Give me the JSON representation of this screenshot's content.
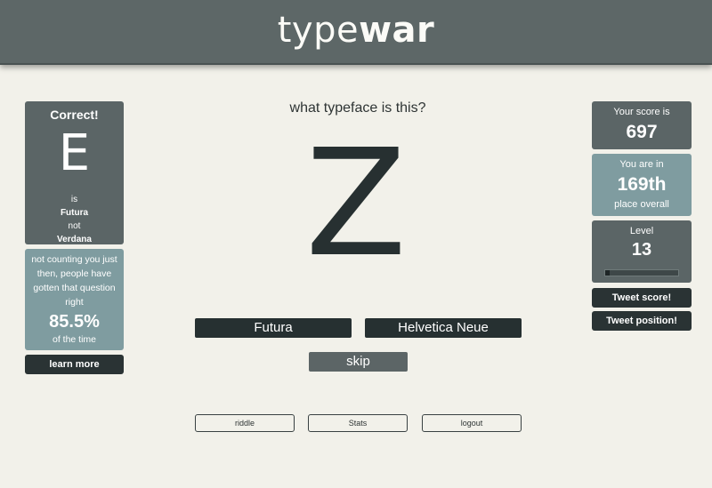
{
  "header": {
    "logo_thin": "type",
    "logo_bold": "war"
  },
  "result": {
    "title": "Correct!",
    "letter": "E",
    "is_label": "is",
    "typeface": "Futura",
    "not_label": "not",
    "other_typeface": "Verdana"
  },
  "fact": {
    "text": "not counting you just then, people have gotten that question right",
    "percent": "85.5%",
    "suffix": "of the time",
    "learn_more": "learn more"
  },
  "quiz": {
    "question": "what typeface is this?",
    "glyph": "Z",
    "options": [
      "Futura",
      "Helvetica Neue"
    ],
    "skip": "skip"
  },
  "footer": {
    "links": [
      "riddle",
      "Stats",
      "logout"
    ]
  },
  "stats": {
    "score_label": "Your score is",
    "score": "697",
    "rank_label": "You are in",
    "rank": "169th",
    "rank_suffix": "place overall",
    "level_label": "Level",
    "level": "13",
    "level_progress": 0.06,
    "tweet_score": "Tweet score!",
    "tweet_position": "Tweet position!"
  },
  "colors": {
    "header": "#5d6767",
    "panel_dark": "#5b6566",
    "panel_teal": "#7f9ca0",
    "button_black": "#2a3334",
    "background": "#f2f1ea"
  }
}
